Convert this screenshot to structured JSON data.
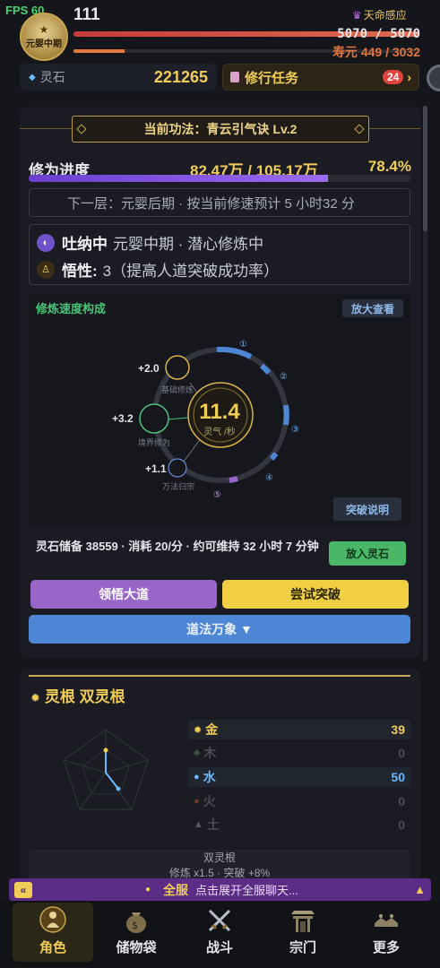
{
  "fps": "FPS 60",
  "player": {
    "realm_badge": "元婴中期",
    "level": "111",
    "fate_label": "天命感应",
    "hp_text": "5070 / 5070",
    "hp_fraction": 1.0,
    "lifespan_text": "寿元 449 / 3032",
    "lifespan_fraction": 0.148
  },
  "resources": {
    "stone_label": "灵石",
    "stone_value": "221265",
    "task_label": "修行任务",
    "task_badge": "24",
    "task_arrow": "›"
  },
  "cultivation": {
    "technique": "当前功法：青云引气诀 Lv.2",
    "progress_label": "修为进度",
    "progress_value": "82.47万 / 105.17万",
    "progress_percent": "78.4%",
    "progress_fraction": 0.784,
    "next_layer": "下一层：元婴后期 · 按当前修速预计 5 小时32 分",
    "state_key": "吐纳中",
    "state_text": "元婴中期 · 潜心修炼中",
    "aptitude_key": "悟性:",
    "aptitude_text": "3（提高人道突破成功率）"
  },
  "speed": {
    "title": "修炼速度构成",
    "zoom_label": "放大查看",
    "explain_label": "突破说明",
    "core_value": "11.4",
    "core_unit": "灵气 /秒",
    "sources": [
      {
        "value": "+2.0",
        "label": "基础修炼"
      },
      {
        "value": "+3.2",
        "label": "境界修为"
      },
      {
        "value": "+1.1",
        "label": "万法归宗"
      }
    ],
    "ring_markers": [
      "①",
      "②",
      "③",
      "④",
      "⑤"
    ]
  },
  "reserve": {
    "text": "灵石储备 38559 · 消耗 20/分 · 约可维持 32 小时 7 分钟",
    "put_label": "放入灵石"
  },
  "actions": {
    "comprehend_label": "领悟大道",
    "breakthrough_label": "尝试突破",
    "dharma_label": "道法万象 ▼"
  },
  "spirit_root": {
    "title": "灵根  双灵根",
    "elements": [
      {
        "name": "金",
        "value": "39",
        "color": "#f1cd58",
        "active": true
      },
      {
        "name": "木",
        "value": "0",
        "color": "#4a4c54",
        "active": false
      },
      {
        "name": "水",
        "value": "50",
        "color": "#6ab8ff",
        "active": true
      },
      {
        "name": "火",
        "value": "0",
        "color": "#4a4c54",
        "active": false
      },
      {
        "name": "土",
        "value": "0",
        "color": "#4a4c54",
        "active": false
      }
    ],
    "summary_line1": "双灵根",
    "summary_line2": "修炼 x1.5 · 突破 +8%"
  },
  "chat": {
    "left_icon": "«",
    "tag": "全服",
    "text": "点击展开全服聊天...",
    "up_icon": "▲"
  },
  "nav": {
    "items": [
      {
        "label": "角色",
        "icon": "character-icon"
      },
      {
        "label": "储物袋",
        "icon": "bag-icon"
      },
      {
        "label": "战斗",
        "icon": "crossed-swords-icon"
      },
      {
        "label": "宗门",
        "icon": "gate-icon"
      },
      {
        "label": "更多",
        "icon": "more-icon"
      }
    ]
  },
  "colors": {
    "accent_gold": "#f1cd58",
    "hp_red": "#c73b3b",
    "life_orange": "#e07a3c",
    "progress_purple": "#7b4fe0",
    "green": "#4ab766",
    "blue": "#4e86d6"
  }
}
